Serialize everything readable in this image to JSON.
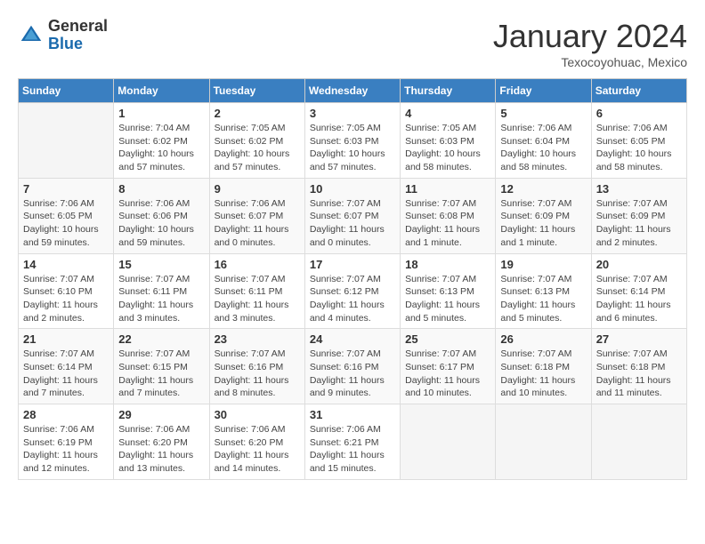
{
  "header": {
    "logo": {
      "general": "General",
      "blue": "Blue"
    },
    "title": "January 2024",
    "location": "Texocoyohuac, Mexico"
  },
  "weekdays": [
    "Sunday",
    "Monday",
    "Tuesday",
    "Wednesday",
    "Thursday",
    "Friday",
    "Saturday"
  ],
  "weeks": [
    [
      {
        "day": "",
        "info": ""
      },
      {
        "day": "1",
        "info": "Sunrise: 7:04 AM\nSunset: 6:02 PM\nDaylight: 10 hours\nand 57 minutes."
      },
      {
        "day": "2",
        "info": "Sunrise: 7:05 AM\nSunset: 6:02 PM\nDaylight: 10 hours\nand 57 minutes."
      },
      {
        "day": "3",
        "info": "Sunrise: 7:05 AM\nSunset: 6:03 PM\nDaylight: 10 hours\nand 57 minutes."
      },
      {
        "day": "4",
        "info": "Sunrise: 7:05 AM\nSunset: 6:03 PM\nDaylight: 10 hours\nand 58 minutes."
      },
      {
        "day": "5",
        "info": "Sunrise: 7:06 AM\nSunset: 6:04 PM\nDaylight: 10 hours\nand 58 minutes."
      },
      {
        "day": "6",
        "info": "Sunrise: 7:06 AM\nSunset: 6:05 PM\nDaylight: 10 hours\nand 58 minutes."
      }
    ],
    [
      {
        "day": "7",
        "info": "Sunrise: 7:06 AM\nSunset: 6:05 PM\nDaylight: 10 hours\nand 59 minutes."
      },
      {
        "day": "8",
        "info": "Sunrise: 7:06 AM\nSunset: 6:06 PM\nDaylight: 10 hours\nand 59 minutes."
      },
      {
        "day": "9",
        "info": "Sunrise: 7:06 AM\nSunset: 6:07 PM\nDaylight: 11 hours\nand 0 minutes."
      },
      {
        "day": "10",
        "info": "Sunrise: 7:07 AM\nSunset: 6:07 PM\nDaylight: 11 hours\nand 0 minutes."
      },
      {
        "day": "11",
        "info": "Sunrise: 7:07 AM\nSunset: 6:08 PM\nDaylight: 11 hours\nand 1 minute."
      },
      {
        "day": "12",
        "info": "Sunrise: 7:07 AM\nSunset: 6:09 PM\nDaylight: 11 hours\nand 1 minute."
      },
      {
        "day": "13",
        "info": "Sunrise: 7:07 AM\nSunset: 6:09 PM\nDaylight: 11 hours\nand 2 minutes."
      }
    ],
    [
      {
        "day": "14",
        "info": "Sunrise: 7:07 AM\nSunset: 6:10 PM\nDaylight: 11 hours\nand 2 minutes."
      },
      {
        "day": "15",
        "info": "Sunrise: 7:07 AM\nSunset: 6:11 PM\nDaylight: 11 hours\nand 3 minutes."
      },
      {
        "day": "16",
        "info": "Sunrise: 7:07 AM\nSunset: 6:11 PM\nDaylight: 11 hours\nand 3 minutes."
      },
      {
        "day": "17",
        "info": "Sunrise: 7:07 AM\nSunset: 6:12 PM\nDaylight: 11 hours\nand 4 minutes."
      },
      {
        "day": "18",
        "info": "Sunrise: 7:07 AM\nSunset: 6:13 PM\nDaylight: 11 hours\nand 5 minutes."
      },
      {
        "day": "19",
        "info": "Sunrise: 7:07 AM\nSunset: 6:13 PM\nDaylight: 11 hours\nand 5 minutes."
      },
      {
        "day": "20",
        "info": "Sunrise: 7:07 AM\nSunset: 6:14 PM\nDaylight: 11 hours\nand 6 minutes."
      }
    ],
    [
      {
        "day": "21",
        "info": "Sunrise: 7:07 AM\nSunset: 6:14 PM\nDaylight: 11 hours\nand 7 minutes."
      },
      {
        "day": "22",
        "info": "Sunrise: 7:07 AM\nSunset: 6:15 PM\nDaylight: 11 hours\nand 7 minutes."
      },
      {
        "day": "23",
        "info": "Sunrise: 7:07 AM\nSunset: 6:16 PM\nDaylight: 11 hours\nand 8 minutes."
      },
      {
        "day": "24",
        "info": "Sunrise: 7:07 AM\nSunset: 6:16 PM\nDaylight: 11 hours\nand 9 minutes."
      },
      {
        "day": "25",
        "info": "Sunrise: 7:07 AM\nSunset: 6:17 PM\nDaylight: 11 hours\nand 10 minutes."
      },
      {
        "day": "26",
        "info": "Sunrise: 7:07 AM\nSunset: 6:18 PM\nDaylight: 11 hours\nand 10 minutes."
      },
      {
        "day": "27",
        "info": "Sunrise: 7:07 AM\nSunset: 6:18 PM\nDaylight: 11 hours\nand 11 minutes."
      }
    ],
    [
      {
        "day": "28",
        "info": "Sunrise: 7:06 AM\nSunset: 6:19 PM\nDaylight: 11 hours\nand 12 minutes."
      },
      {
        "day": "29",
        "info": "Sunrise: 7:06 AM\nSunset: 6:20 PM\nDaylight: 11 hours\nand 13 minutes."
      },
      {
        "day": "30",
        "info": "Sunrise: 7:06 AM\nSunset: 6:20 PM\nDaylight: 11 hours\nand 14 minutes."
      },
      {
        "day": "31",
        "info": "Sunrise: 7:06 AM\nSunset: 6:21 PM\nDaylight: 11 hours\nand 15 minutes."
      },
      {
        "day": "",
        "info": ""
      },
      {
        "day": "",
        "info": ""
      },
      {
        "day": "",
        "info": ""
      }
    ]
  ]
}
